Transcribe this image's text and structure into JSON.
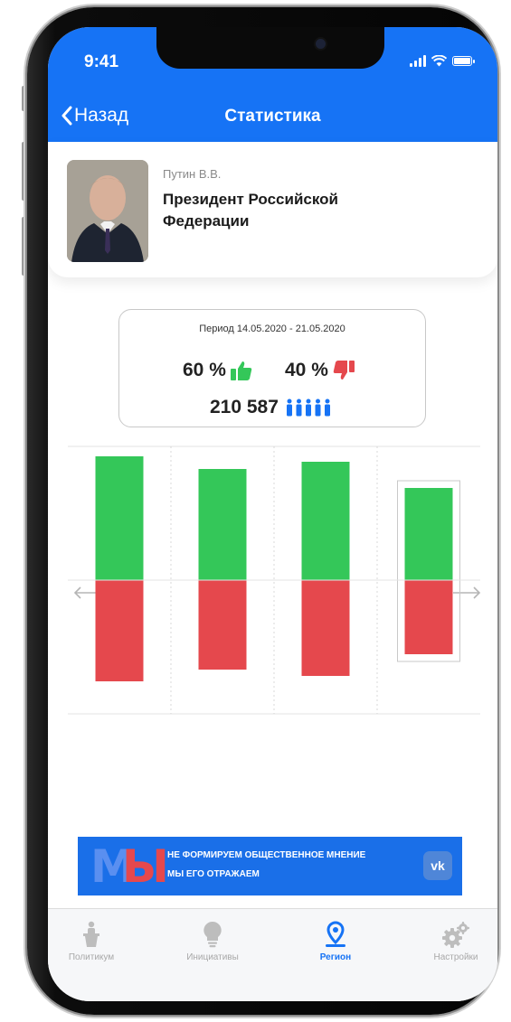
{
  "status_bar": {
    "time": "9:41"
  },
  "nav": {
    "back_label": "Назад",
    "title": "Статистика"
  },
  "profile": {
    "name": "Путин В.В.",
    "position": "Президент Российской Федерации"
  },
  "stats": {
    "period": "Период 14.05.2020 - 21.05.2020",
    "likes": "60 %",
    "dislikes": "40 %",
    "voters": "210 587"
  },
  "colors": {
    "accent": "#1673F5",
    "positive": "#34C759",
    "negative": "#E5484D"
  },
  "chart_data": {
    "type": "bar",
    "series": [
      {
        "values": [
          1.37,
          1.23,
          1.31,
          1.02
        ]
      },
      {
        "values": [
          1.12,
          0.99,
          1.06,
          0.82
        ]
      }
    ],
    "selected_index": 3,
    "baseline": 0
  },
  "banner": {
    "logo": "МЫ",
    "line1": "НЕ ФОРМИРУЕМ ОБЩЕСТВЕННОЕ МНЕНИЕ",
    "line2": "МЫ ЕГО ОТРАЖАЕМ",
    "vk": "vk"
  },
  "tabs": [
    {
      "label": "Политикум",
      "icon": "podium-icon"
    },
    {
      "label": "Инициативы",
      "icon": "lightbulb-icon"
    },
    {
      "label": "Регион",
      "icon": "location-pin-icon"
    },
    {
      "label": "Настройки",
      "icon": "gears-icon"
    }
  ]
}
